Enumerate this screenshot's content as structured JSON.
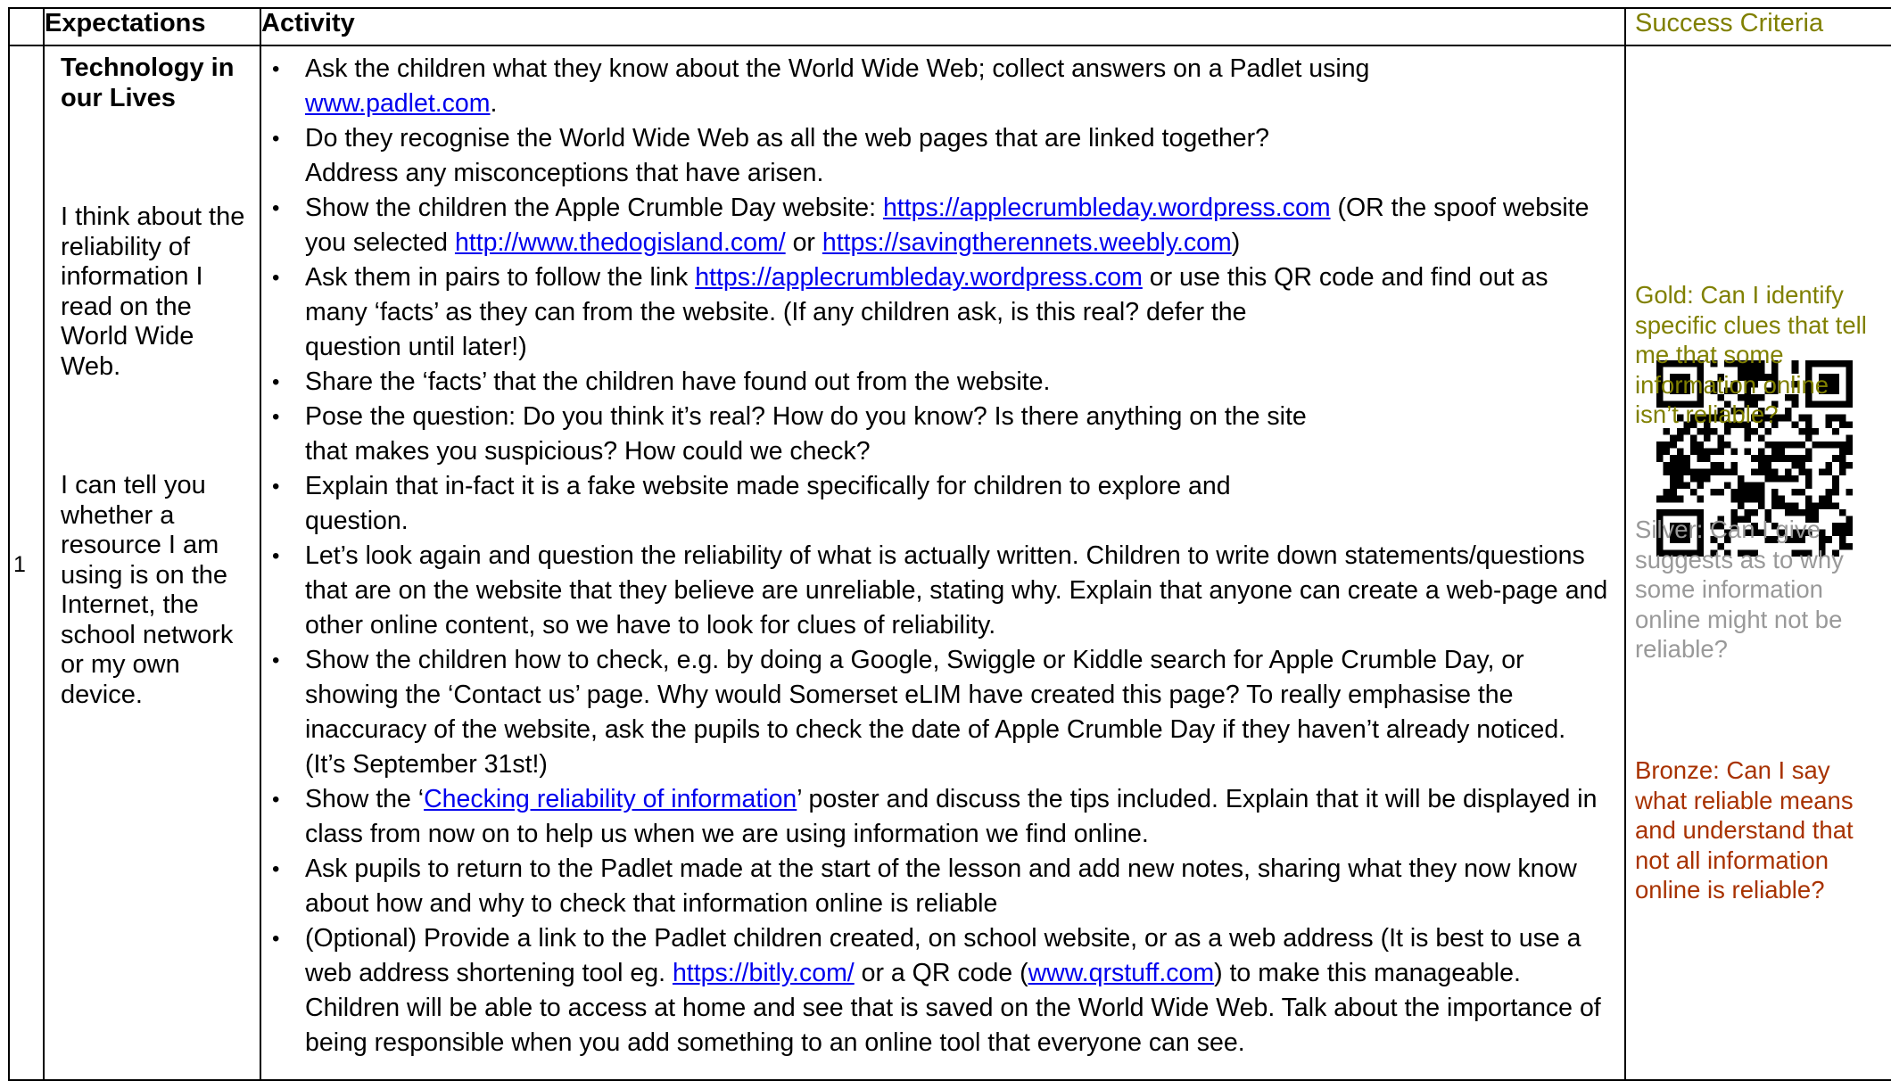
{
  "headers": {
    "number": "",
    "expectations": "Expectations",
    "activity": "Activity",
    "success_criteria": "Success Criteria"
  },
  "row": {
    "number": "1",
    "topic": "Technology in our Lives",
    "expectation_1": "I think about the reliability of information I read on the World Wide Web.",
    "expectation_2": "I can tell you whether a resource I am using is on the Internet, the school network or my own device."
  },
  "activity": {
    "b1_text": "Ask the children what they know about the World Wide Web; collect answers on a Padlet using",
    "b1_link": "www.padlet.com",
    "b1_end": ".",
    "b2": "Do they recognise the World Wide Web as all the web pages that are linked together?  Address any misconceptions that have arisen.",
    "b3_text": "Show the children the Apple Crumble Day website:",
    "b3_link1": "https://applecrumbleday.wordpress.com",
    "b3_mid": " (OR the spoof website you selected",
    "b3_link2": "http://www.thedogisland.com/",
    "b3_or": "or",
    "b3_link3": "https://savingtherennets.weebly.com",
    "b3_end": ")",
    "b4_text": "Ask them in pairs to follow the link",
    "b4_link": "https://applecrumbleday.wordpress.com",
    "b4_rest1": "or use this QR code and find out as",
    "b4_rest2": "many ‘facts’ as they can from the website. (If any children ask, is this real? defer the",
    "b4_rest3": "question until later!)",
    "b5": "Share the ‘facts’ that the children have found out from the website.",
    "b6_line1": "Pose the question: Do you think it’s real? How do you know?  Is there anything on the site",
    "b6_line2": "that makes you suspicious? How could we check?",
    "b7_line1": "Explain that in-fact it is a fake website made specifically for children to explore and",
    "b7_line2": "question.",
    "b8": "Let’s look again and question the reliability of what is actually written. Children to write down statements/questions that are on the website that they believe are unreliable, stating why.  Explain that anyone can create a web-page and other online content, so we have to look for clues of reliability.",
    "b9": "Show the children how to check, e.g. by doing a Google, Swiggle or Kiddle search for Apple Crumble Day, or showing the ‘Contact us’ page. Why would Somerset eLIM have created this page? To really emphasise the inaccuracy of the website, ask the pupils to check the date of Apple Crumble Day if they haven’t already noticed. (It’s September 31st!)",
    "b10_pre": "Show the ‘",
    "b10_link": "Checking reliability of information",
    "b10_post": "’ poster and discuss the tips included. Explain that it will be displayed in class from now on to help us when we are using information we find online.",
    "b11": "Ask pupils to return to the Padlet made at the start of the lesson and add new notes, sharing what they now know about how and why to check that information online is reliable",
    "b12_a": "(Optional) Provide a link to the Padlet children created, on school website, or as a web address (It is best to use a web address shortening tool eg.",
    "b12_link1": "https://bitly.com/",
    "b12_b": "or a QR code (",
    "b12_link2": "www.qrstuff.com",
    "b12_c": ")  to make this manageable. Children will be able to access at home and see that is saved on the World Wide Web.  Talk about the importance of being responsible when you add something to an online tool that everyone can see."
  },
  "success_criteria": {
    "gold": "Gold: Can I identify specific clues that tell me that some information online isn’t reliable?",
    "silver": "Silver: Can I give suggests as to why some information online might not be reliable?",
    "bronze": "Bronze: Can I say what reliable means and understand that not all information online is reliable?"
  },
  "colors": {
    "gold": "#808000",
    "silver": "#999999",
    "bronze": "#a83200",
    "link": "#0000ee"
  },
  "qr_code": "qr-code-image"
}
